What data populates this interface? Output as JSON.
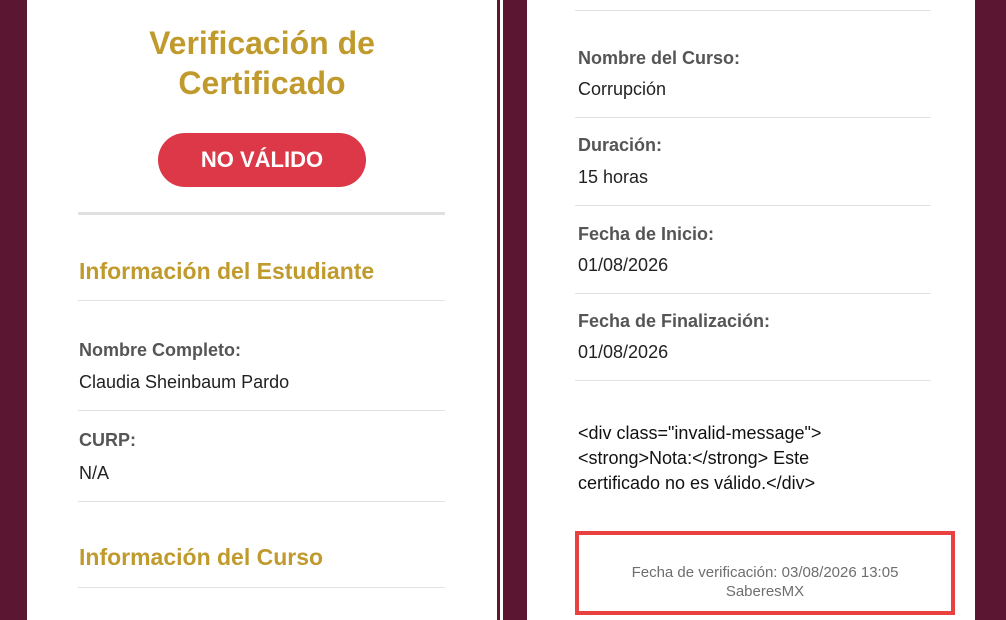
{
  "left": {
    "title_line1": "Verificación de",
    "title_line2": "Certificado",
    "status_badge": "NO VÁLIDO",
    "student_section": "Información del Estudiante",
    "full_name_label": "Nombre Completo:",
    "full_name_value": "Claudia Sheinbaum Pardo",
    "curp_label": "CURP:",
    "curp_value": "N/A",
    "course_section": "Información del Curso"
  },
  "right": {
    "course_name_label": "Nombre del Curso:",
    "course_name_value": "Corrupción",
    "duration_label": "Duración:",
    "duration_value": "15 horas",
    "start_date_label": "Fecha de Inicio:",
    "start_date_value": "01/08/2026",
    "end_date_label": "Fecha de Finalización:",
    "end_date_value": "01/08/2026",
    "raw_line1": "<div class=\"invalid-message\">",
    "raw_line2": "<strong>Nota:</strong> Este",
    "raw_line3": "certificado no es válido.</div>",
    "verification_text": "Fecha de verificación: 03/08/2026 13:05",
    "footer_brand": "SaberesMX"
  },
  "colors": {
    "accent_gold": "#c09a2c",
    "badge_red": "#dc3848",
    "frame_maroon": "#5b1632",
    "highlight_red": "#e9413f"
  }
}
